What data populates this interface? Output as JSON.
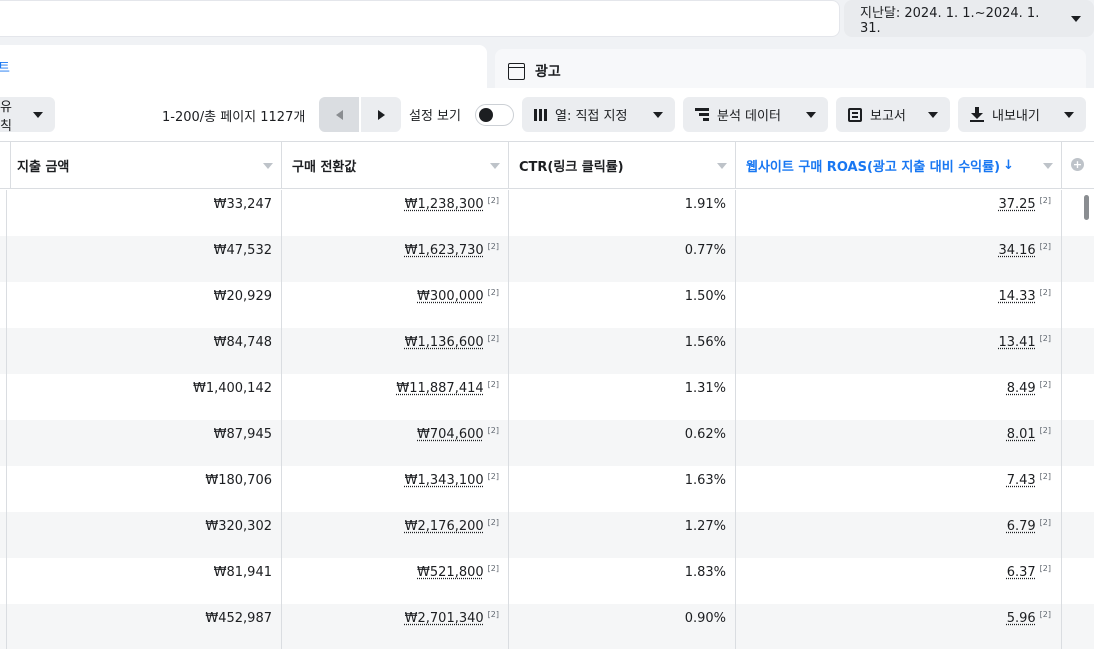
{
  "header": {
    "date_range": "지난달: 2024. 1. 1.~2024. 1. 31."
  },
  "tabs": {
    "left_partial_label": "트",
    "ads_label": "광고"
  },
  "toolbar": {
    "attribution_partial": "유칙",
    "paging_text": "1-200/총 페이지 1127개",
    "setting_view_label": "설정 보기",
    "columns_button": "열: 직접 지정",
    "breakdown_button": "분석 데이터",
    "reports_button": "보고서",
    "export_button": "내보내기"
  },
  "table": {
    "columns": [
      "지출 금액",
      "구매 전환값",
      "CTR(링크 클릭률)",
      "웹사이트 구매 ROAS(광고 지출 대비 수익률)"
    ],
    "sort_arrow": "↓",
    "add_column_symbol": "+",
    "footnote": "[2]",
    "rows": [
      {
        "spend": "₩33,247",
        "purchase_value": "₩1,238,300",
        "ctr": "1.91%",
        "roas": "37.25"
      },
      {
        "spend": "₩47,532",
        "purchase_value": "₩1,623,730",
        "ctr": "0.77%",
        "roas": "34.16"
      },
      {
        "spend": "₩20,929",
        "purchase_value": "₩300,000",
        "ctr": "1.50%",
        "roas": "14.33"
      },
      {
        "spend": "₩84,748",
        "purchase_value": "₩1,136,600",
        "ctr": "1.56%",
        "roas": "13.41"
      },
      {
        "spend": "₩1,400,142",
        "purchase_value": "₩11,887,414",
        "ctr": "1.31%",
        "roas": "8.49"
      },
      {
        "spend": "₩87,945",
        "purchase_value": "₩704,600",
        "ctr": "0.62%",
        "roas": "8.01"
      },
      {
        "spend": "₩180,706",
        "purchase_value": "₩1,343,100",
        "ctr": "1.63%",
        "roas": "7.43"
      },
      {
        "spend": "₩320,302",
        "purchase_value": "₩2,176,200",
        "ctr": "1.27%",
        "roas": "6.79"
      },
      {
        "spend": "₩81,941",
        "purchase_value": "₩521,800",
        "ctr": "1.83%",
        "roas": "6.37"
      },
      {
        "spend": "₩452,987",
        "purchase_value": "₩2,701,340",
        "ctr": "0.90%",
        "roas": "5.96"
      }
    ]
  },
  "colors": {
    "accent": "#1877f2",
    "row_alt": "#f5f6f7",
    "button_bg": "#ebedf0"
  }
}
